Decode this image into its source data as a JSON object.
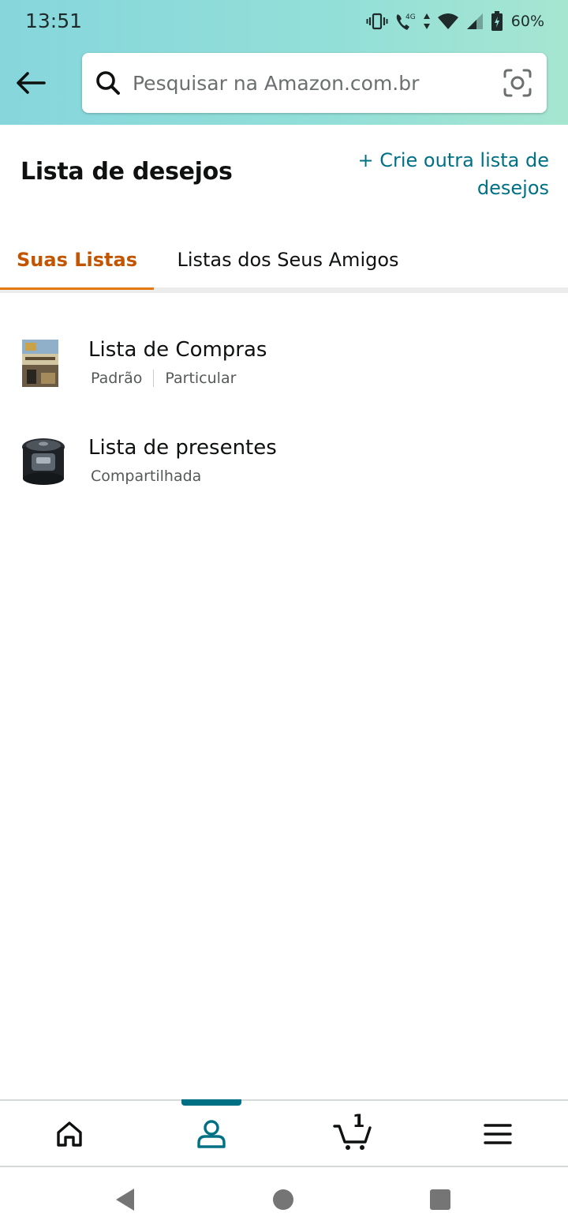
{
  "status_bar": {
    "time": "13:51",
    "battery": "60%",
    "icons": [
      "vibrate-icon",
      "wifi-call-4g-icon",
      "wifi-icon",
      "signal-icon",
      "battery-charging-icon"
    ]
  },
  "header": {
    "back_icon": "arrow-left-icon",
    "search": {
      "placeholder": "Pesquisar na Amazon.com.br",
      "value": "",
      "icon": "search-icon",
      "camera_icon": "camera-search-icon"
    },
    "gradient_colors": [
      "#86d6dc",
      "#a6e6d1"
    ]
  },
  "page": {
    "title": "Lista de desejos",
    "create_link": "+ Crie outra lista de desejos"
  },
  "tabs": [
    {
      "label": "Suas Listas",
      "active": true
    },
    {
      "label": "Listas dos Seus Amigos",
      "active": false
    }
  ],
  "lists": [
    {
      "name": "Lista de Compras",
      "tags": [
        "Padrão",
        "Particular"
      ],
      "thumbnail": "book-cover-thumbnail"
    },
    {
      "name": "Lista de presentes",
      "tags": [
        "Compartilhada"
      ],
      "thumbnail": "rice-cooker-thumbnail"
    }
  ],
  "bottom_nav": {
    "items": [
      "home-icon",
      "account-icon",
      "cart-icon",
      "menu-icon"
    ],
    "active": "account-icon",
    "cart_count": "1"
  },
  "system_nav": [
    "back-triangle-icon",
    "home-circle-icon",
    "recents-square-icon"
  ],
  "colors": {
    "accent_link": "#007185",
    "active_tab_text": "#c45500",
    "active_tab_underline": "#e47911"
  }
}
